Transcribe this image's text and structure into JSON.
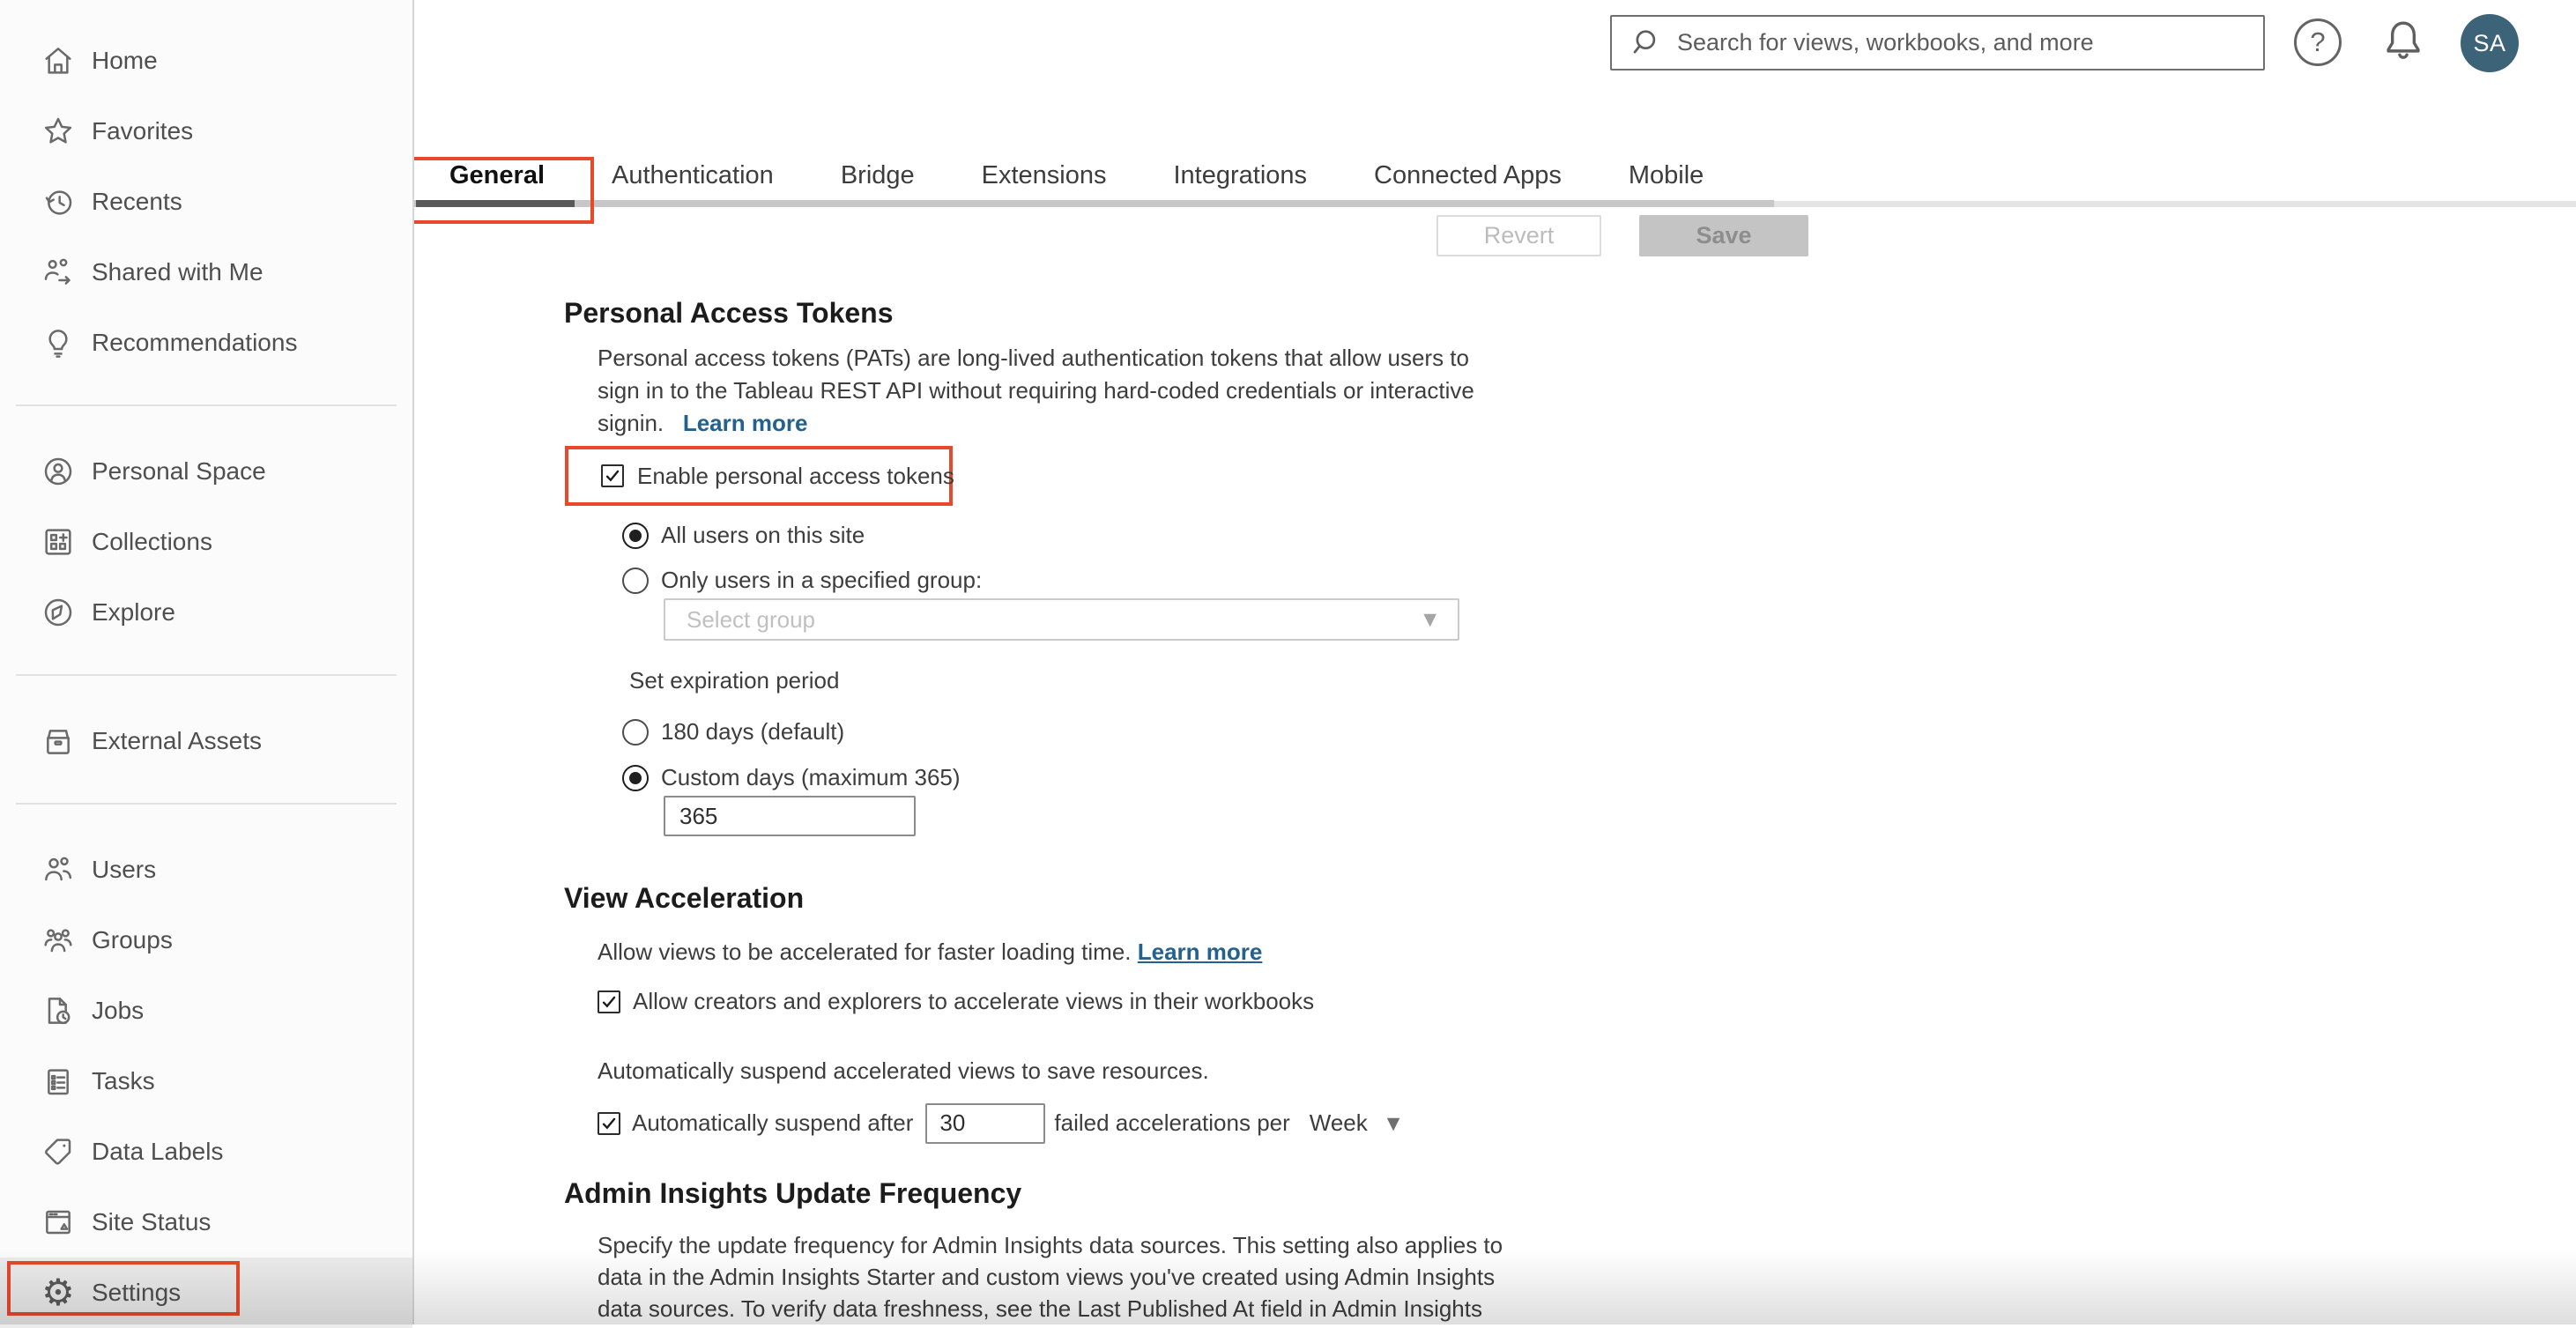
{
  "topbar": {
    "search_placeholder": "Search for views, workbooks, and more",
    "avatar_initials": "SA"
  },
  "sidebar": {
    "items": [
      {
        "label": "Home",
        "icon": "home"
      },
      {
        "label": "Favorites",
        "icon": "star"
      },
      {
        "label": "Recents",
        "icon": "clock"
      },
      {
        "label": "Shared with Me",
        "icon": "shared"
      },
      {
        "label": "Recommendations",
        "icon": "lightbulb"
      },
      {
        "label": "Personal Space",
        "icon": "person-circle"
      },
      {
        "label": "Collections",
        "icon": "collections"
      },
      {
        "label": "Explore",
        "icon": "compass"
      },
      {
        "label": "External Assets",
        "icon": "asset-box"
      },
      {
        "label": "Users",
        "icon": "users"
      },
      {
        "label": "Groups",
        "icon": "groups"
      },
      {
        "label": "Jobs",
        "icon": "document-clock"
      },
      {
        "label": "Tasks",
        "icon": "clipboard"
      },
      {
        "label": "Data Labels",
        "icon": "tag"
      },
      {
        "label": "Site Status",
        "icon": "browser-status"
      },
      {
        "label": "Settings",
        "icon": "gear"
      }
    ],
    "selected": "Settings"
  },
  "tabs": {
    "items": [
      "General",
      "Authentication",
      "Bridge",
      "Extensions",
      "Integrations",
      "Connected Apps",
      "Mobile"
    ],
    "active": "General"
  },
  "actions": {
    "revert_label": "Revert",
    "save_label": "Save"
  },
  "sections": {
    "pat": {
      "heading": "Personal Access Tokens",
      "description_lines": [
        "Personal access tokens (PATs) are long-lived authentication tokens that allow users to",
        "sign in to the Tableau REST API without requiring hard-coded credentials or interactive"
      ],
      "description_tail": "signin.",
      "learn_more_label": "Learn more",
      "enable_label": "Enable personal access tokens",
      "enable_checked": true,
      "radio_all_users": "All users on this site",
      "radio_specified_group": "Only users in a specified group:",
      "group_select_placeholder": "Select group",
      "expiration_label": "Set expiration period",
      "radio_180_days": "180 days (default)",
      "radio_custom_days": "Custom days (maximum 365)",
      "custom_days_value": "365"
    },
    "view_acceleration": {
      "heading": "View Acceleration",
      "intro": "Allow views to be accelerated for faster loading time.",
      "learn_more_label": "Learn more",
      "allow_label": "Allow creators and explorers to accelerate views in their workbooks",
      "allow_checked": true,
      "suspend_intro": "Automatically suspend accelerated views to save resources.",
      "suspend_prefix": "Automatically suspend after",
      "suspend_value": "30",
      "suspend_suffix": "failed accelerations per",
      "period_value": "Week",
      "suspend_checked": true
    },
    "admin_insights": {
      "heading": "Admin Insights Update Frequency",
      "description_lines": [
        "Specify the update frequency for Admin Insights data sources. This setting also applies to",
        "data in the Admin Insights Starter and custom views you've created using Admin Insights",
        "data sources. To verify data freshness, see the Last Published At field in Admin Insights"
      ]
    }
  },
  "colors": {
    "accent_red": "#e8492b",
    "link_blue": "#24618e",
    "avatar_bg": "#3d6379",
    "tab_indicator": "#595959"
  }
}
